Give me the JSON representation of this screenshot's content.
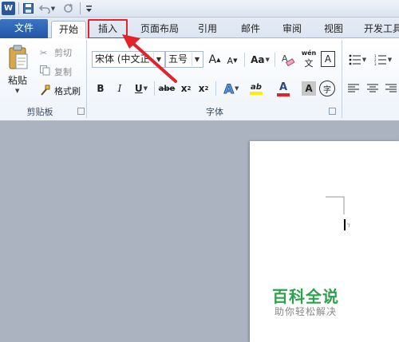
{
  "titlebar": {
    "app_icon": "W",
    "save_icon": "save-icon",
    "undo_icon": "undo-icon",
    "redo_icon": "redo-icon",
    "customize_icon": "customize-qat-icon"
  },
  "tabs": {
    "file": "文件",
    "home": "开始",
    "insert": "插入",
    "page_layout": "页面布局",
    "references": "引用",
    "mailings": "邮件",
    "review": "审阅",
    "view": "视图",
    "developer": "开发工具"
  },
  "clipboard": {
    "paste": "粘贴",
    "cut": "剪切",
    "copy": "复制",
    "format_painter": "格式刷",
    "group_label": "剪贴板"
  },
  "font": {
    "font_name": "宋体 (中文正",
    "font_size": "五号",
    "grow": "A",
    "shrink": "A",
    "change_case": "Aa",
    "clear_format": "A",
    "phonetic": "wén",
    "char_border": "A",
    "bold": "B",
    "italic": "I",
    "underline": "U",
    "strike": "abe",
    "subscript": "x",
    "superscript": "x",
    "text_effect": "A",
    "highlight": "ab",
    "font_color": "A",
    "char_shading": "A",
    "enclose": "字",
    "group_label": "字体"
  },
  "colors": {
    "highlight": "#ffee00",
    "font_color": "#e2232a",
    "accent": "#2b579a",
    "brand": "#2aa34a",
    "annotation": "#e2232a"
  },
  "watermark": {
    "title": "百科全说",
    "subtitle": "助你轻松解决"
  }
}
